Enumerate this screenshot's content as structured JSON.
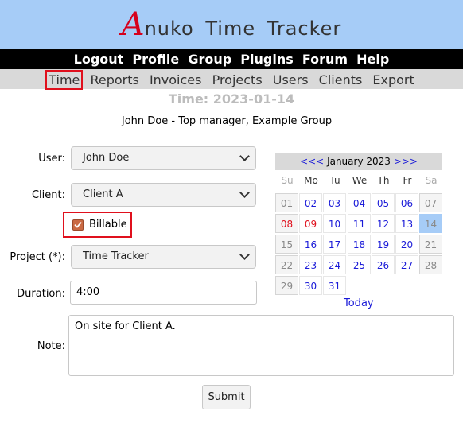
{
  "logo": {
    "initial": "A",
    "text": "nuko Time Tracker"
  },
  "top_menu": [
    "Logout",
    "Profile",
    "Group",
    "Plugins",
    "Forum",
    "Help"
  ],
  "sub_menu": [
    "Time",
    "Reports",
    "Invoices",
    "Projects",
    "Users",
    "Clients",
    "Export"
  ],
  "sub_menu_selected": "Time",
  "page_title": "Time: 2023-01-14",
  "page_subtitle": "John Doe - Top manager, Example Group",
  "form": {
    "user_label": "User:",
    "user_value": "John Doe",
    "client_label": "Client:",
    "client_value": "Client A",
    "billable_label": "Billable",
    "billable_checked": true,
    "project_label": "Project (*):",
    "project_value": "Time Tracker",
    "duration_label": "Duration:",
    "duration_value": "4:00",
    "note_label": "Note:",
    "note_value": "On site for Client A.",
    "submit_label": "Submit"
  },
  "calendar": {
    "prev_label": "<<<",
    "next_label": ">>>",
    "month_label": "January 2023",
    "weekdays": [
      "Su",
      "Mo",
      "Tu",
      "We",
      "Th",
      "Fr",
      "Sa"
    ],
    "weeks": [
      [
        "01",
        "02",
        "03",
        "04",
        "05",
        "06",
        "07"
      ],
      [
        "08",
        "09",
        "10",
        "11",
        "12",
        "13",
        "14"
      ],
      [
        "15",
        "16",
        "17",
        "18",
        "19",
        "20",
        "21"
      ],
      [
        "22",
        "23",
        "24",
        "25",
        "26",
        "27",
        "28"
      ],
      [
        "29",
        "30",
        "31",
        "",
        "",
        "",
        ""
      ]
    ],
    "holidays": [
      "08",
      "09"
    ],
    "selected_day": "14",
    "today_label": "Today"
  },
  "colors": {
    "header_bg": "#a6ccf7",
    "logo_accent": "#d6001c",
    "highlight_border": "#e0101d",
    "link": "#1a1ad8"
  }
}
